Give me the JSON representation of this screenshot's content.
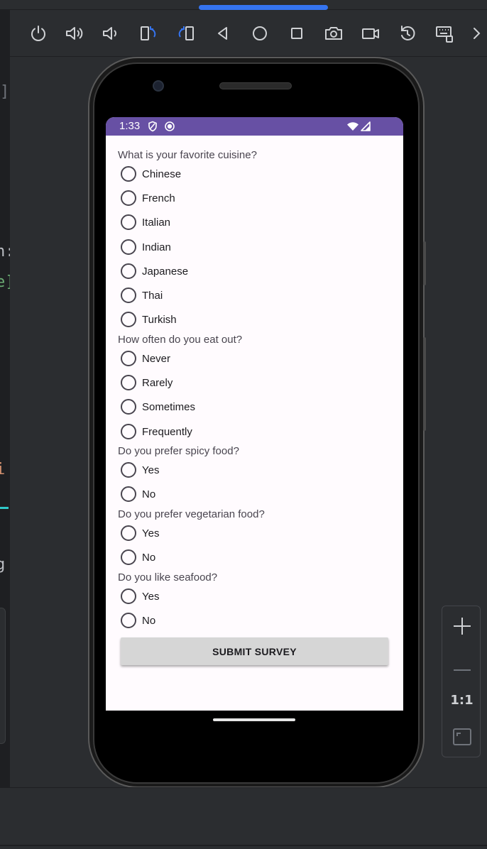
{
  "toolbar": {
    "buttons": [
      {
        "name": "power-icon"
      },
      {
        "name": "volume-up-icon"
      },
      {
        "name": "volume-down-icon"
      },
      {
        "name": "rotate-left-icon"
      },
      {
        "name": "rotate-right-icon"
      },
      {
        "name": "back-icon"
      },
      {
        "name": "home-icon"
      },
      {
        "name": "overview-icon"
      },
      {
        "name": "camera-icon"
      },
      {
        "name": "screenrecord-icon"
      },
      {
        "name": "reset-icon"
      },
      {
        "name": "keyboard-icon"
      },
      {
        "name": "more-chevron-icon"
      }
    ],
    "accent": "#3574f0"
  },
  "editor_fragments": {
    "f1": "]",
    "f2": "n:",
    "f3": "e]",
    "f4": "i",
    "f5": "g"
  },
  "zoom": {
    "zoom_in": "+",
    "zoom_out": "—",
    "actual_size": "1:1"
  },
  "status_bar": {
    "time": "1:33",
    "color": "#6750a4"
  },
  "survey": {
    "questions": [
      {
        "text": "What is your favorite cuisine?",
        "options": [
          "Chinese",
          "French",
          "Italian",
          "Indian",
          "Japanese",
          "Thai",
          "Turkish"
        ]
      },
      {
        "text": "How often do you eat out?",
        "options": [
          "Never",
          "Rarely",
          "Sometimes",
          "Frequently"
        ]
      },
      {
        "text": "Do you prefer spicy food?",
        "options": [
          "Yes",
          "No"
        ]
      },
      {
        "text": "Do you prefer vegetarian food?",
        "options": [
          "Yes",
          "No"
        ]
      },
      {
        "text": "Do you like seafood?",
        "options": [
          "Yes",
          "No"
        ]
      }
    ],
    "submit_label": "SUBMIT SURVEY"
  }
}
